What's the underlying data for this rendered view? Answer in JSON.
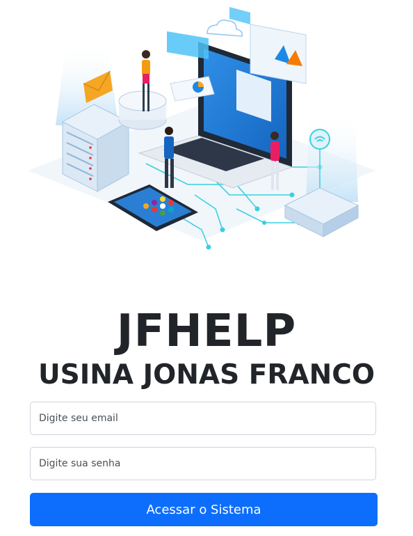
{
  "hero": {
    "illustration": "technology-isometric-illustration"
  },
  "brand": {
    "title": "JFHELP",
    "subtitle": "USINA JONAS FRANCO"
  },
  "login": {
    "email_placeholder": "Digite seu email",
    "email_value": "",
    "password_placeholder": "Digite sua senha",
    "password_value": "",
    "submit_label": "Acessar o Sistema"
  },
  "colors": {
    "primary": "#0d6efd",
    "text": "#212529",
    "border": "#ced4da"
  }
}
